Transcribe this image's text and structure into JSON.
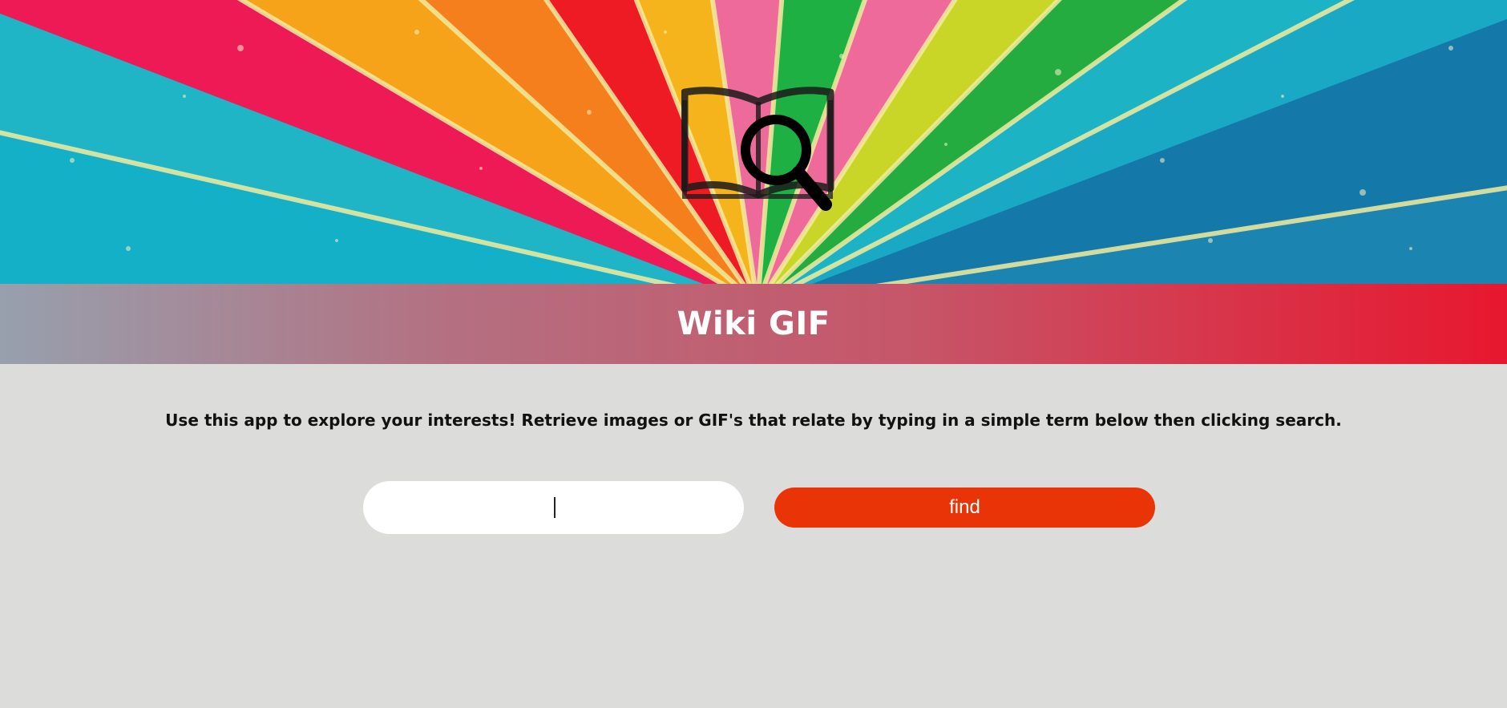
{
  "header": {
    "title": "Wiki GIF"
  },
  "intro": {
    "text": "Use this app to explore your interests! Retrieve images or GIF's that relate by typing in a simple term below then clicking search."
  },
  "search": {
    "value": "",
    "placeholder": "",
    "button_label": "find"
  },
  "icons": {
    "logo": "book-magnifier-icon"
  },
  "colors": {
    "page_bg": "#dcdcdb",
    "button": "#e83406",
    "title_gradient_start": "#97a0ad",
    "title_gradient_end": "#e7172f",
    "title_text": "#ffffff"
  }
}
